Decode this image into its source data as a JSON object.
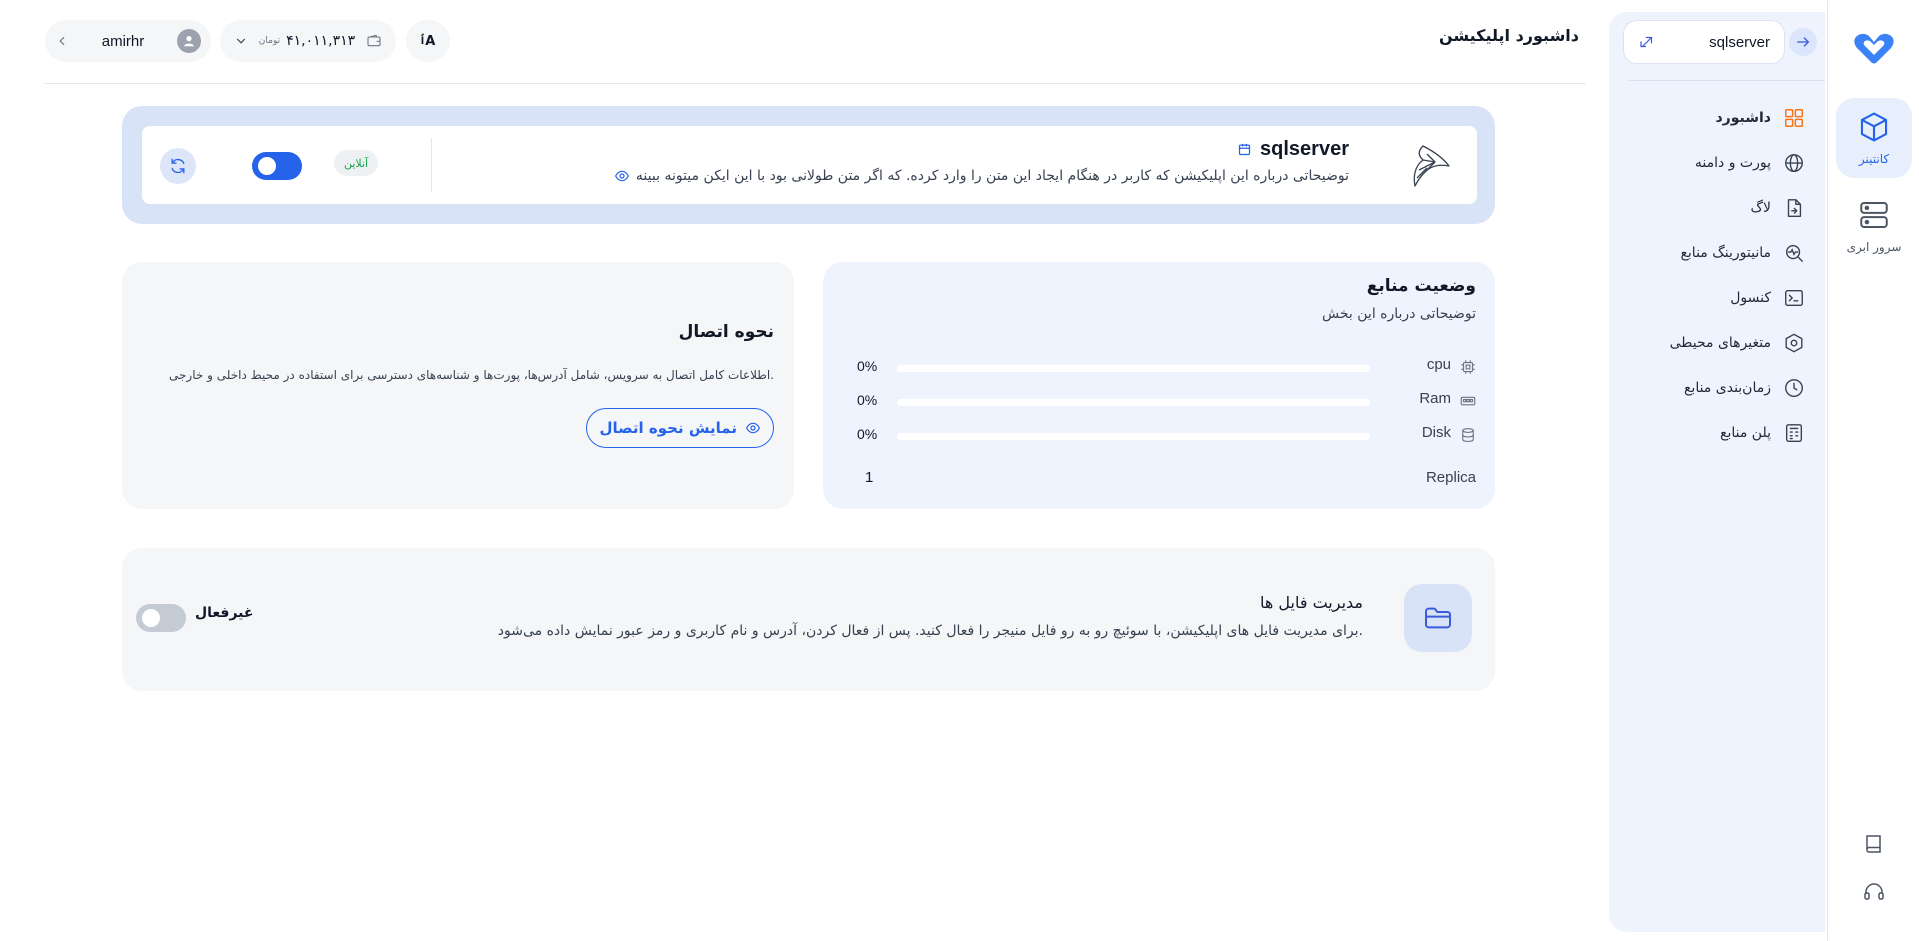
{
  "rail": {
    "items": [
      {
        "label": "کانتینر"
      },
      {
        "label": "سرور ابری"
      }
    ]
  },
  "sidebar": {
    "current_app": "sqlserver",
    "items": [
      {
        "label": "داشبورد",
        "icon": "dashboard-icon",
        "active": true
      },
      {
        "label": "پورت و دامنه",
        "icon": "globe-icon"
      },
      {
        "label": "لاگ",
        "icon": "log-file-icon"
      },
      {
        "label": "مانیتورینگ منابع",
        "icon": "monitoring-icon"
      },
      {
        "label": "کنسول",
        "icon": "terminal-icon"
      },
      {
        "label": "متغیرهای محیطی",
        "icon": "env-hexagon-icon"
      },
      {
        "label": "زمان‌بندی منابع",
        "icon": "clock-icon"
      },
      {
        "label": "پلن منابع",
        "icon": "plan-calculator-icon"
      }
    ]
  },
  "header": {
    "title": "داشبورد اپلیکیشن",
    "user": "amirhr",
    "balance": "۴۱,۰۱۱,۳۱۳",
    "currency": "تومان",
    "lang_label": "A"
  },
  "app": {
    "name": "sqlserver",
    "description": "توضیحاتی درباره این اپلیکیشن که کاربر در هنگام ایجاد این متن را وارد کرده. که اگر متن طولانی بود با این ایکن میتونه ببینه",
    "status": "آنلاین"
  },
  "resources": {
    "title": "وضعیت منابع",
    "subtitle": "توضیحاتی درباره این بخش",
    "meters": [
      {
        "name": "cpu",
        "percent": "0%",
        "value": 0,
        "icon": "cpu-icon"
      },
      {
        "name": "Ram",
        "percent": "0%",
        "value": 0,
        "icon": "ram-icon"
      },
      {
        "name": "Disk",
        "percent": "0%",
        "value": 0,
        "icon": "disk-icon"
      }
    ],
    "replica_label": "Replica",
    "replica_value": "1"
  },
  "connection": {
    "title": "نحوه اتصال",
    "description": "اطلاعات کامل اتصال به سرویس، شامل آدرس‌ها، پورت‌ها و شناسه‌های دسترسی برای استفاده در محیط داخلی و خارجی.",
    "button": "نمایش نحوه اتصال"
  },
  "files": {
    "title": "مدیریت فایل ها",
    "description": "برای مدیریت فایل های اپلیکیشن، با سوئیچ رو به رو فایل منیجر را فعال کنید. پس از فعال کردن، آدرس و نام کاربری و رمز عبور نمایش داده می‌شود.",
    "status": "غیرفعال"
  },
  "colors": {
    "accent": "#2563eb",
    "active_nav_icon": "#f97316",
    "online": "#16a34a"
  }
}
